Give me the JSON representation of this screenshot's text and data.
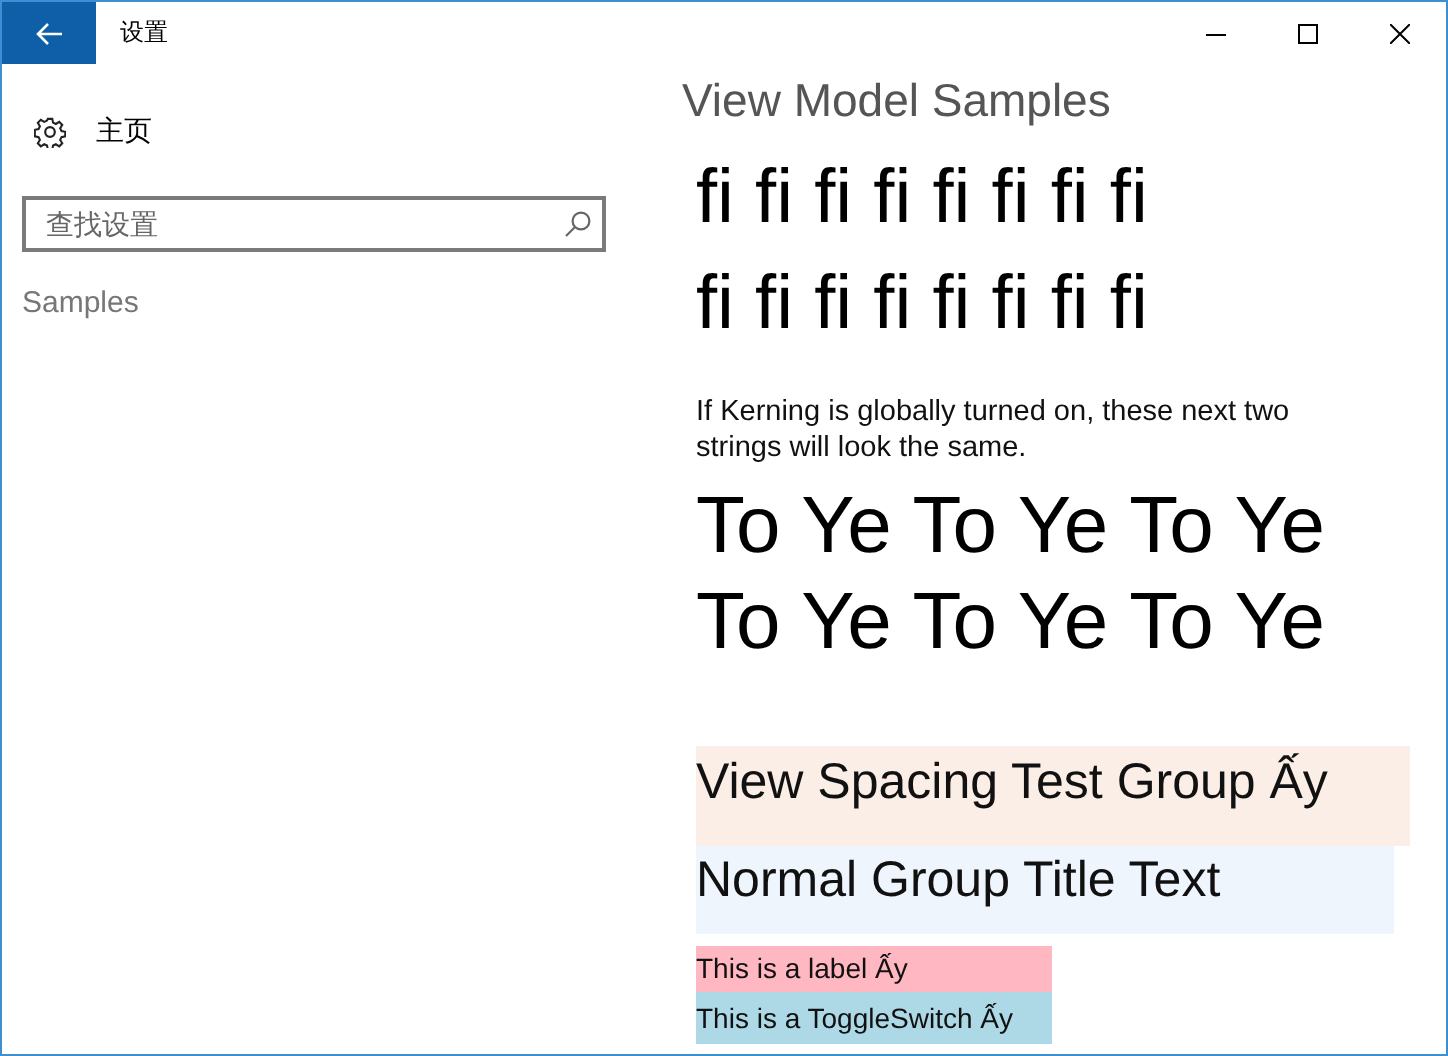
{
  "window": {
    "title": "设置"
  },
  "sidebar": {
    "home": "主页",
    "search": {
      "placeholder": "查找设置"
    },
    "sections": [
      "Samples"
    ]
  },
  "content": {
    "title": "View Model Samples",
    "ligature_rows": [
      "fi fi fi fi fi fi fi fi",
      "fi fi fi fi fi fi fi fi"
    ],
    "note": "If Kerning is globally turned on, these next two strings will look the same.",
    "kerning_rows": [
      "To Ye To Ye To Ye",
      "To Ye To Ye To Ye"
    ],
    "groups": [
      {
        "kind": "spacing",
        "title": "View Spacing Test Group Ấy"
      },
      {
        "kind": "normal",
        "title": "Normal Group Title Text"
      }
    ],
    "rows": [
      {
        "kind": "label",
        "text": "This is a label Ấy"
      },
      {
        "kind": "toggle",
        "text": "This is a ToggleSwitch Ấy"
      }
    ]
  }
}
